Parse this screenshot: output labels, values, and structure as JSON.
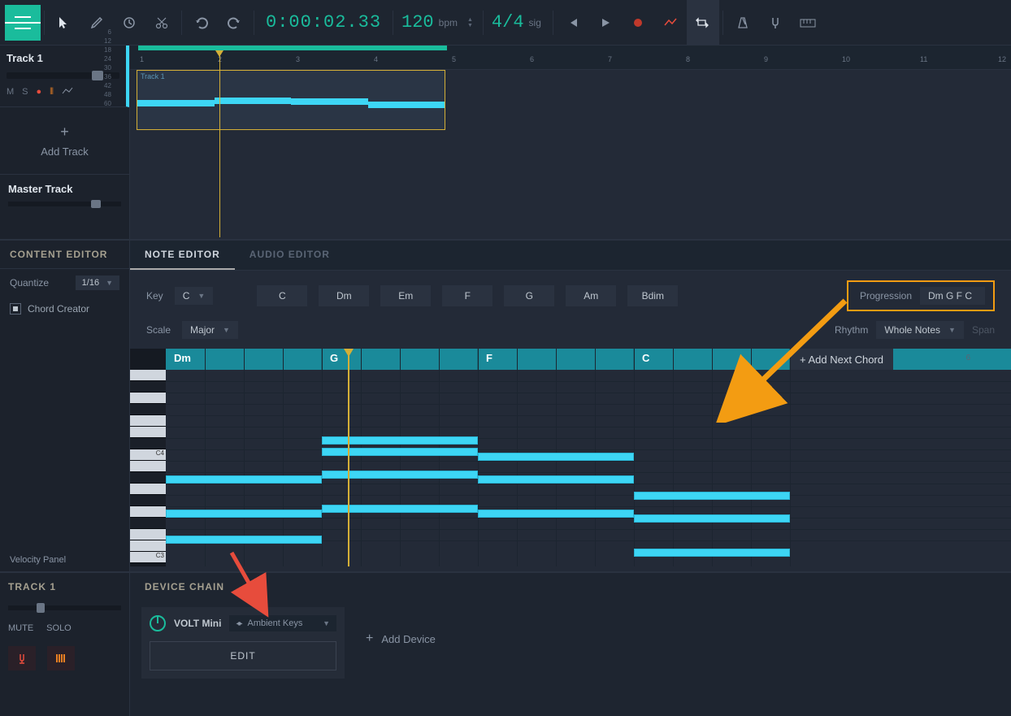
{
  "toolbar": {
    "time": "0:00:02.33",
    "bpm": "120",
    "bpm_label": "bpm",
    "timesig": "4/4",
    "sig_label": "sig"
  },
  "tracks": {
    "track1_name": "Track 1",
    "mute": "M",
    "solo": "S",
    "add_track": "Add Track",
    "master": "Master Track"
  },
  "arrangement": {
    "clip_label": "Track 1",
    "ruler_marks": [
      "1",
      "2",
      "3",
      "4",
      "5",
      "6",
      "7",
      "8",
      "9",
      "10",
      "11",
      "12"
    ]
  },
  "content_editor": {
    "title": "CONTENT EDITOR",
    "quantize_label": "Quantize",
    "quantize_value": "1/16",
    "chord_creator": "Chord Creator"
  },
  "note_editor": {
    "tab_note": "NOTE EDITOR",
    "tab_audio": "AUDIO EDITOR",
    "key_label": "Key",
    "key_value": "C",
    "scale_label": "Scale",
    "scale_value": "Major",
    "chords": [
      "C",
      "Dm",
      "Em",
      "F",
      "G",
      "Am",
      "Bdim"
    ],
    "progression_label": "Progression",
    "progression_value": "Dm G F C",
    "rhythm_label": "Rhythm",
    "rhythm_value": "Whole Notes",
    "span_label": "Span",
    "chord_sequence": [
      "Dm",
      "G",
      "F",
      "C"
    ],
    "add_next_chord": "+ Add Next Chord",
    "chord_ruler_6": "6",
    "key_c4": "C4",
    "key_c3": "C3",
    "velocity_panel": "Velocity Panel"
  },
  "device": {
    "track_title": "TRACK 1",
    "mute": "MUTE",
    "solo": "SOLO",
    "chain_title": "DEVICE CHAIN",
    "device_name": "VOLT Mini",
    "preset": "Ambient Keys",
    "edit": "EDIT",
    "add_device": "Add Device",
    "db_marks": [
      "6",
      "12",
      "18",
      "24",
      "30",
      "36",
      "42",
      "48",
      "60"
    ]
  }
}
